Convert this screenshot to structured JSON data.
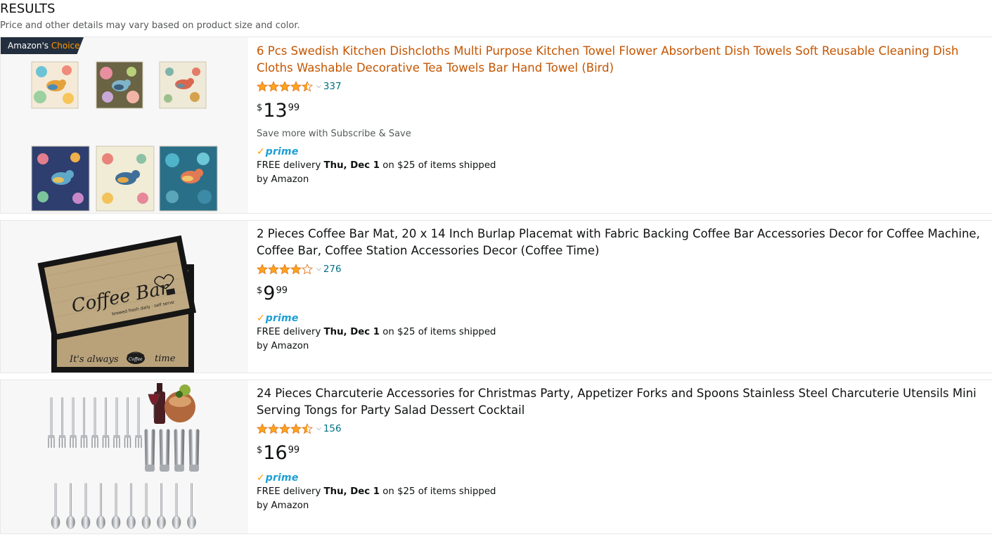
{
  "header": {
    "title": "RESULTS",
    "disclaimer": "Price and other details may vary based on product size and color."
  },
  "colors": {
    "star": "#ffa41c",
    "link_orange": "#c45500",
    "rating_count": "#007185",
    "prime_blue": "#1b9ed5",
    "prime_check": "#ff9900",
    "badge_bg": "#232f3e"
  },
  "products": [
    {
      "badge": {
        "prefix": "Amazon's",
        "suffix": "Choice"
      },
      "title": "6 Pcs Swedish Kitchen Dishcloths Multi Purpose Kitchen Towel Flower Absorbent Dish Towels Soft Reusable Cleaning Dish Cloths Washable Decorative Tea Towels Bar Hand Towel (Bird)",
      "rating": 4.5,
      "rating_count": "337",
      "price": {
        "symbol": "$",
        "whole": "13",
        "fraction": "99"
      },
      "subscribe": "Save more with Subscribe & Save",
      "prime": {
        "check": "✓",
        "label": "prime"
      },
      "delivery": {
        "prefix": "FREE delivery",
        "date": "Thu, Dec 1",
        "suffix": "on $25 of items shipped by Amazon"
      },
      "image_icon": "bird-dishcloths-image"
    },
    {
      "title": "2 Pieces Coffee Bar Mat, 20 x 14 Inch Burlap Placemat with Fabric Backing Coffee Bar Accessories Decor for Coffee Machine, Coffee Bar, Coffee Station Accessories Decor (Coffee Time)",
      "rating": 4.0,
      "rating_count": "276",
      "price": {
        "symbol": "$",
        "whole": "9",
        "fraction": "99"
      },
      "prime": {
        "check": "✓",
        "label": "prime"
      },
      "delivery": {
        "prefix": "FREE delivery",
        "date": "Thu, Dec 1",
        "suffix": "on $25 of items shipped by Amazon"
      },
      "image_text": {
        "main": "Coffee Bar",
        "tagline": "brewed fresh daily · self serve",
        "bottom_left": "It's always",
        "cup": "Coffee",
        "bottom_right": "time"
      },
      "image_icon": "coffee-bar-mat-image"
    },
    {
      "title": "24 Pieces Charcuterie Accessories for Christmas Party, Appetizer Forks and Spoons Stainless Steel Charcuterie Utensils Mini Serving Tongs for Party Salad Dessert Cocktail",
      "rating": 4.5,
      "rating_count": "156",
      "price": {
        "symbol": "$",
        "whole": "16",
        "fraction": "99"
      },
      "prime": {
        "check": "✓",
        "label": "prime"
      },
      "delivery": {
        "prefix": "FREE delivery",
        "date": "Thu, Dec 1",
        "suffix": "on $25 of items shipped by Amazon"
      },
      "image_icon": "charcuterie-utensils-image"
    }
  ]
}
